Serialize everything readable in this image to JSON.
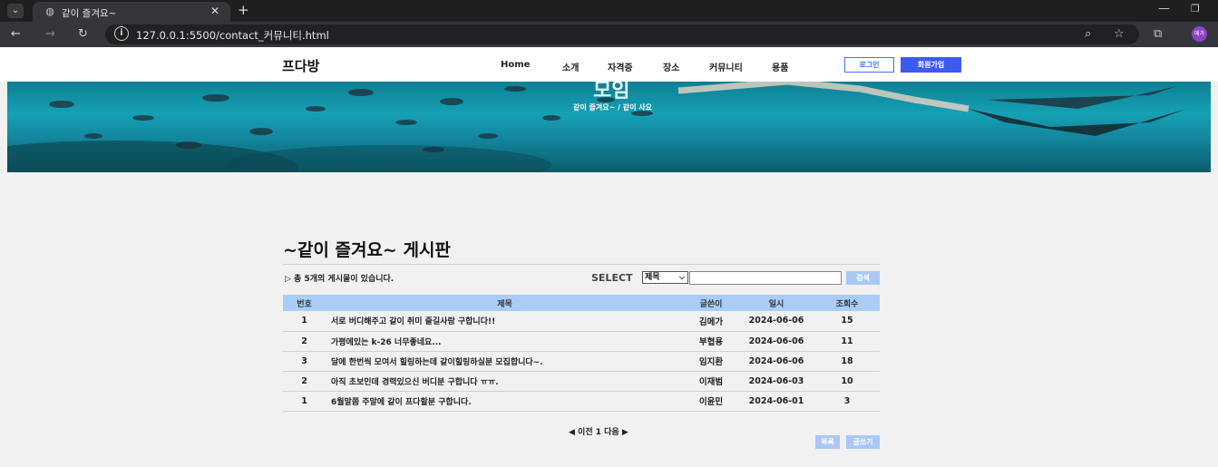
{
  "browser": {
    "tab_title": "같이 즐겨요~",
    "url": "127.0.0.1:5500/contact_커뮤니티.html",
    "profile_label": "메가"
  },
  "header": {
    "logo": "프다방",
    "nav": [
      "Home",
      "소개",
      "자격증",
      "장소",
      "커뮤니티",
      "용품"
    ],
    "login_label": "로그인",
    "join_label": "회원가입"
  },
  "hero": {
    "title": "모임",
    "breadcrumb": "같이 즐겨요~ / 같이 사요"
  },
  "board": {
    "title": "~같이 즐겨요~ 게시판",
    "count_text": "▷ 총 5개의 게시물이 있습니다.",
    "select_label": "SELECT",
    "select_value": "제목",
    "search_value": "",
    "search_button": "검색",
    "columns": [
      "번호",
      "제목",
      "글쓴이",
      "일시",
      "조회수"
    ],
    "rows": [
      {
        "no": "1",
        "subject": "서로 버디해주고 같이 취미 즐길사람 구합니다!!",
        "writer": "김메가",
        "date": "2024-06-06",
        "views": "15"
      },
      {
        "no": "2",
        "subject": "가평에있는 k-26 너무좋네요...",
        "writer": "부협용",
        "date": "2024-06-06",
        "views": "11"
      },
      {
        "no": "3",
        "subject": "달에 한번씩 모여서 힐링하는데 같이힐링하실분 모집합니다~.",
        "writer": "임지환",
        "date": "2024-06-06",
        "views": "18"
      },
      {
        "no": "2",
        "subject": "아직 초보인데 경력있으신 버디분 구합니다 ㅠㅠ.",
        "writer": "이재범",
        "date": "2024-06-03",
        "views": "10"
      },
      {
        "no": "1",
        "subject": "6월말쯤 주말에 같이 프다할분 구합니다.",
        "writer": "이윤민",
        "date": "2024-06-01",
        "views": "3"
      }
    ],
    "pager": "◀ 이전 1 다음 ▶",
    "list_button": "목록",
    "write_button": "글쓰기"
  }
}
